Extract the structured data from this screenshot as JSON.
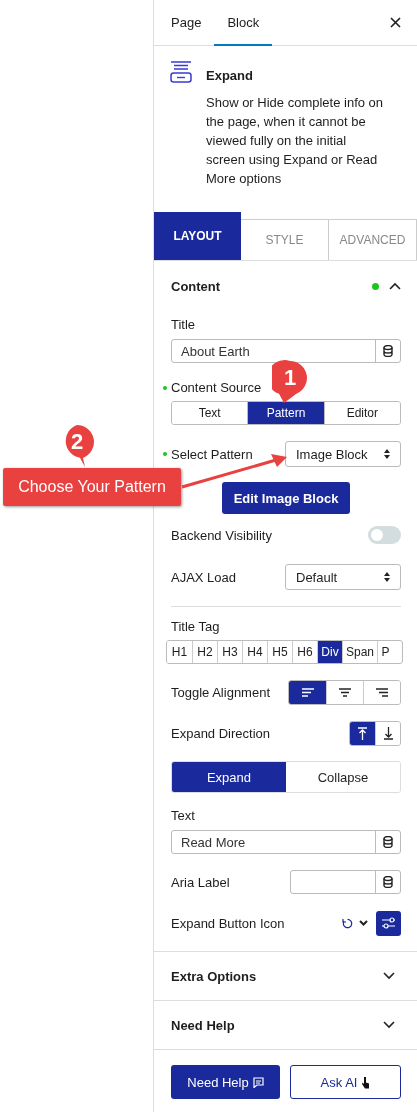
{
  "sidebar_tabs": [
    {
      "label": "Page",
      "selected": false
    },
    {
      "label": "Block",
      "selected": true
    }
  ],
  "block": {
    "name": "Expand",
    "description": "Show or Hide complete info on the page, when it cannot be viewed fully on the initial screen using Expand or Read More options"
  },
  "panel_tabs": [
    {
      "label": "LAYOUT",
      "selected": true
    },
    {
      "label": "STYLE",
      "selected": false
    },
    {
      "label": "ADVANCED",
      "selected": false
    }
  ],
  "content_section": {
    "title": "Content",
    "expanded": true,
    "modified": true,
    "controls": [
      {
        "kind": "text",
        "label": "Title",
        "value": "About Earth"
      },
      {
        "kind": "segmented",
        "label": "Content Source",
        "modified": true,
        "options": [
          {
            "label": "Text",
            "selected": false
          },
          {
            "label": "Pattern",
            "selected": true
          },
          {
            "label": "Editor",
            "selected": false
          }
        ]
      },
      {
        "kind": "select",
        "label": "Select Pattern",
        "modified": true,
        "value": "Image Block"
      },
      {
        "kind": "button",
        "label": "Edit Image Block"
      },
      {
        "kind": "toggle",
        "label": "Backend Visibility",
        "on": false
      },
      {
        "kind": "select",
        "label": "AJAX Load",
        "modified": false,
        "value": "Default"
      },
      {
        "kind": "tags",
        "label": "Title Tag",
        "options": [
          {
            "label": "H1",
            "selected": false
          },
          {
            "label": "H2",
            "selected": false
          },
          {
            "label": "H3",
            "selected": false
          },
          {
            "label": "H4",
            "selected": false
          },
          {
            "label": "H5",
            "selected": false
          },
          {
            "label": "H6",
            "selected": false
          },
          {
            "label": "Div",
            "selected": true
          },
          {
            "label": "Span",
            "selected": false
          },
          {
            "label": "P",
            "selected": false
          }
        ]
      },
      {
        "kind": "alignment",
        "label": "Toggle Alignment",
        "options": [
          {
            "selected": true
          },
          {
            "selected": false
          },
          {
            "selected": false
          }
        ]
      },
      {
        "kind": "direction",
        "label": "Expand Direction",
        "options": [
          {
            "selected": true
          },
          {
            "selected": false
          }
        ]
      },
      {
        "kind": "switcher",
        "options": [
          {
            "label": "Expand",
            "selected": true
          },
          {
            "label": "Collapse",
            "selected": false
          }
        ]
      },
      {
        "kind": "text",
        "label": "Text",
        "value": "Read More"
      },
      {
        "kind": "inline_text",
        "label": "Aria Label"
      },
      {
        "kind": "icon_picker",
        "label": "Expand Button Icon"
      }
    ]
  },
  "sections": [
    {
      "title": "Extra Options",
      "expanded": false
    },
    {
      "title": "Need Help",
      "expanded": false
    }
  ],
  "footer_buttons": [
    {
      "label": "Need Help",
      "kind": "primary"
    },
    {
      "label": "Ask AI",
      "kind": "outline"
    }
  ],
  "annotations": [
    {
      "number": "1"
    },
    {
      "number": "2",
      "text": "Choose Your Pattern"
    }
  ]
}
